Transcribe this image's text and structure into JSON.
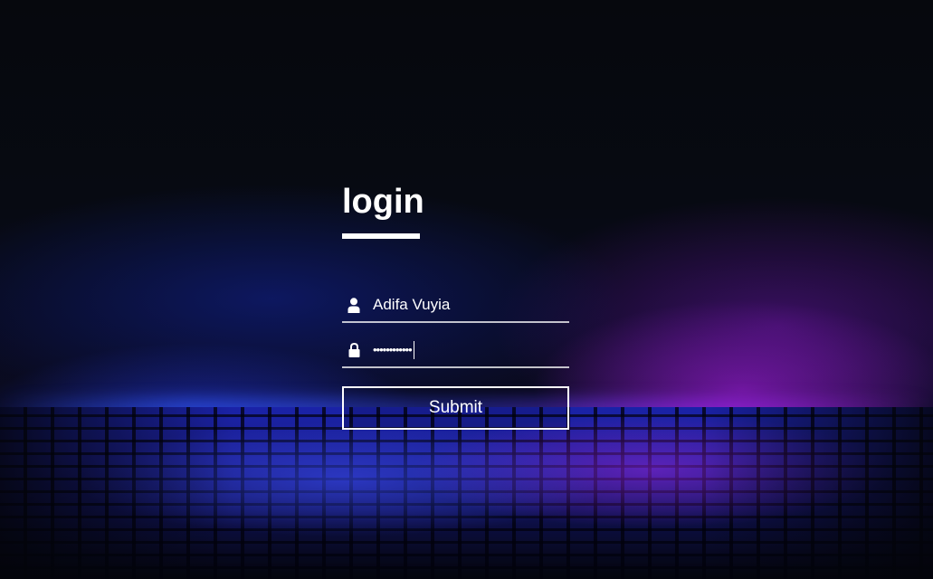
{
  "login": {
    "title": "login",
    "username": {
      "value": "Adifa Vuyia",
      "icon": "user-icon"
    },
    "password": {
      "masked_value": "••••••••••••",
      "icon": "lock-icon"
    },
    "submit_label": "Submit"
  },
  "colors": {
    "text": "#ffffff",
    "glow_blue": "#2a3cff",
    "glow_purple": "#a020e6",
    "background": "#05070c"
  }
}
